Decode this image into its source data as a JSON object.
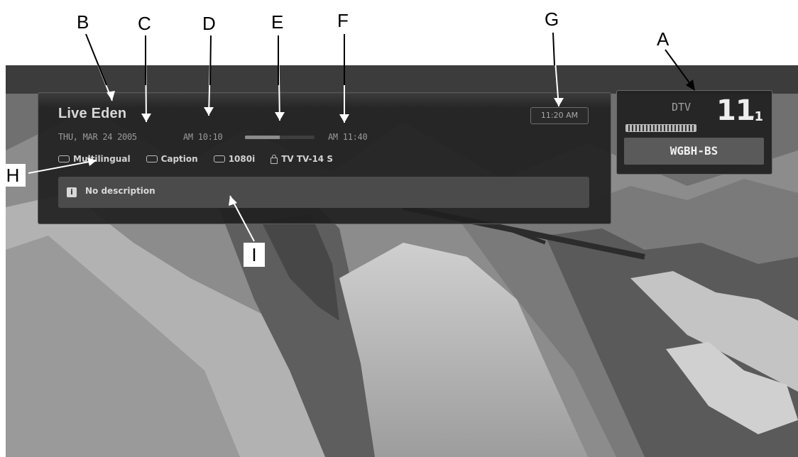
{
  "callouts": {
    "a": "A",
    "b": "B",
    "c": "C",
    "d": "D",
    "e": "E",
    "f": "F",
    "g": "G",
    "h": "H",
    "i": "I"
  },
  "info_panel": {
    "title": "Live Eden",
    "date": "THU, MAR 24 2005",
    "start_time": "AM 10:10",
    "end_time": "AM 11:40",
    "progress_fraction": 0.5,
    "clock": "11:20 AM",
    "features": [
      {
        "icon": "multilingual-icon",
        "label": "Multilingual"
      },
      {
        "icon": "caption-icon",
        "label": "Caption"
      },
      {
        "icon": "resolution-icon",
        "label": "1080i"
      },
      {
        "icon": "lock-icon",
        "label": "TV TV-14 S"
      }
    ],
    "description_icon": "i",
    "description": "No description"
  },
  "channel_panel": {
    "signal_type": "DTV",
    "channel_number": "11",
    "sub_channel": "-1",
    "station": "WGBH-BS"
  },
  "colors": {
    "panel_bg": "#202020",
    "panel_text": "#d8d8d8",
    "description_bg": "#4b4b4b",
    "station_bg": "#5a5a5a"
  }
}
